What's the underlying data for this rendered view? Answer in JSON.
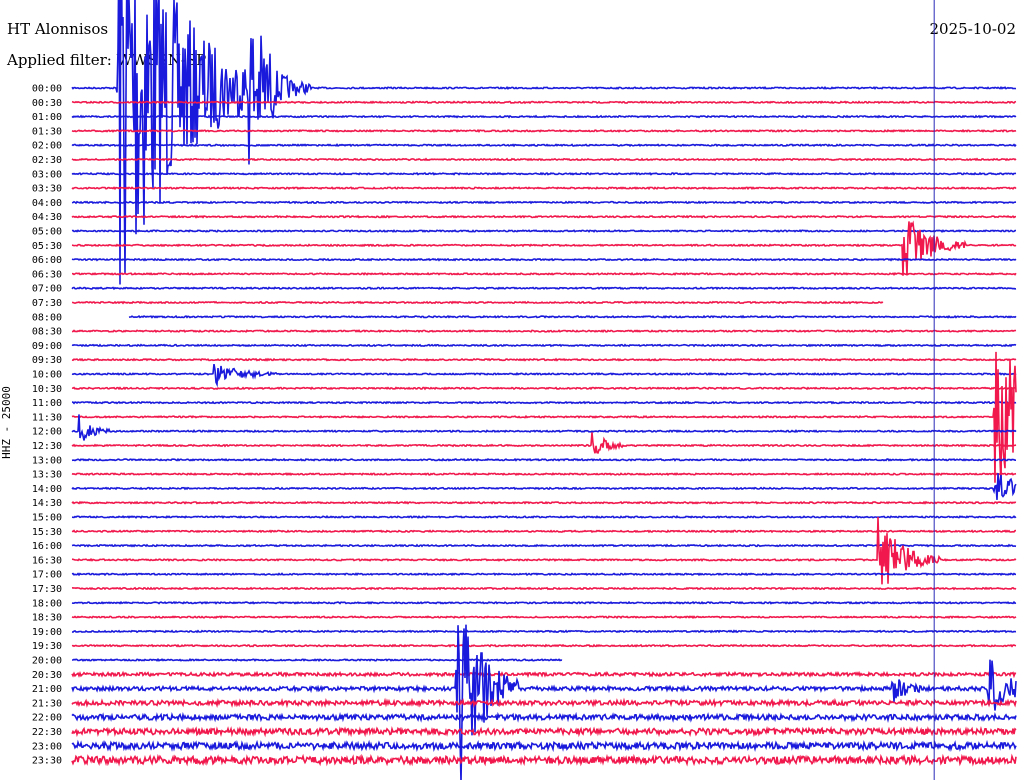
{
  "header": {
    "station": "HT Alonnisos",
    "filter": "Applied filter: WWSSN-SP",
    "date": "2025-10-02"
  },
  "chart_data": {
    "type": "line",
    "title": "HT Alonnisos",
    "ylabel": "HHZ - 25000",
    "colors": {
      "trace_a": "#1a1adc",
      "trace_b": "#f0184c",
      "marker": "#2a2ab8"
    },
    "rows": [
      "00:00",
      "00:30",
      "01:00",
      "01:30",
      "02:00",
      "02:30",
      "03:00",
      "03:30",
      "04:00",
      "04:30",
      "05:00",
      "05:30",
      "06:00",
      "06:30",
      "07:00",
      "07:30",
      "08:00",
      "08:30",
      "09:00",
      "09:30",
      "10:00",
      "10:30",
      "11:00",
      "11:30",
      "12:00",
      "12:30",
      "13:00",
      "13:30",
      "14:00",
      "14:30",
      "15:00",
      "15:30",
      "16:00",
      "16:30",
      "17:00",
      "17:30",
      "18:00",
      "18:30",
      "19:00",
      "19:30",
      "20:00",
      "20:30",
      "21:00",
      "21:30",
      "22:00",
      "22:30",
      "23:00",
      "23:30"
    ],
    "minutes_per_row": 30,
    "row_color_pattern": [
      "trace_a",
      "trace_b"
    ],
    "events": [
      {
        "row": 0,
        "minute": 1.4,
        "amplitude": 20,
        "duration_min": 5
      },
      {
        "row": 0,
        "minute": 5.6,
        "amplitude": 5,
        "duration_min": 2
      },
      {
        "row": 11,
        "minute": 26.4,
        "amplitude": 3,
        "duration_min": 2
      },
      {
        "row": 20,
        "minute": 4.5,
        "amplitude": 1,
        "duration_min": 2
      },
      {
        "row": 23,
        "minute": 29.3,
        "amplitude": 8,
        "duration_min": 3
      },
      {
        "row": 24,
        "minute": 0.2,
        "amplitude": 1.5,
        "duration_min": 1
      },
      {
        "row": 25,
        "minute": 16.5,
        "amplitude": 1.5,
        "duration_min": 1
      },
      {
        "row": 28,
        "minute": 29.3,
        "amplitude": 1.5,
        "duration_min": 2
      },
      {
        "row": 33,
        "minute": 25.6,
        "amplitude": 3.5,
        "duration_min": 2
      },
      {
        "row": 42,
        "minute": 12.2,
        "amplitude": 9,
        "duration_min": 2
      },
      {
        "row": 42,
        "minute": 26.0,
        "amplitude": 1.5,
        "duration_min": 1
      },
      {
        "row": 42,
        "minute": 29.1,
        "amplitude": 3,
        "duration_min": 1.5
      }
    ],
    "gaps": [
      {
        "row": 15,
        "from_minute": 25.8,
        "to_minute": 30
      },
      {
        "row": 16,
        "from_minute": 0,
        "to_minute": 1.8
      },
      {
        "row": 40,
        "from_minute": 15.6,
        "to_minute": 30
      }
    ],
    "markers_minute": [
      27.4
    ]
  }
}
